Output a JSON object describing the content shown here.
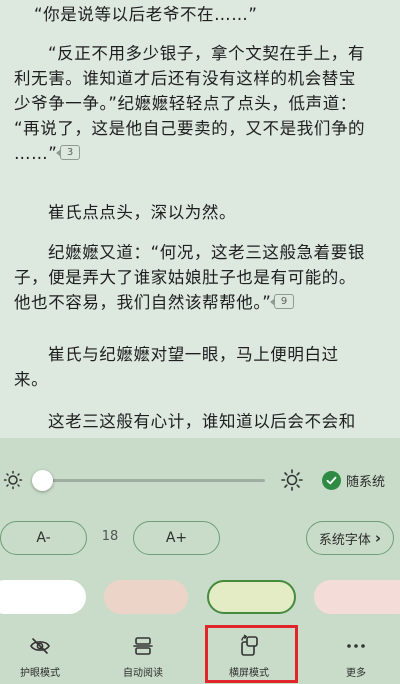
{
  "reader": {
    "paragraphs": [
      {
        "lines": [
          "“你是说等以后老爷不在……”"
        ],
        "badge": ""
      },
      {
        "lines": [
          "“反正不用多少银子，拿个文契在手上，有",
          "利无害。谁知道才后还有没有这样的机会替宝",
          "少爷争一争。”纪嬷嬷轻轻点了点头，低声道：",
          "“再说了，这是他自己要卖的，又不是我们争的",
          "……”"
        ],
        "badge": "3"
      },
      {
        "lines": [
          "崔氏点点头，深以为然。"
        ],
        "badge": ""
      },
      {
        "lines": [
          "纪嬷嬷又道：“何况，这老三这般急着要银",
          "子，便是弄大了谁家姑娘肚子也是有可能的。",
          "他也不容易，我们自然该帮帮他。”"
        ],
        "badge": "9"
      },
      {
        "lines": [
          "崔氏与纪嬷嬷对望一眼，马上便明白过",
          "来。"
        ],
        "badge": ""
      },
      {
        "lines": [
          "这老三这般有心计，谁知道以后会不会和"
        ],
        "badge": ""
      }
    ]
  },
  "panel": {
    "brightness": {
      "level": 0.0,
      "icons": [
        "sun-small-icon",
        "sun-large-icon"
      ]
    },
    "follow_system": {
      "label": "随系统",
      "checked": true,
      "icon": "check-circle-icon"
    },
    "font": {
      "decrease_label": "A-",
      "size_value": "18",
      "increase_label": "A+",
      "face_label": "系统字体",
      "face_chevron": "›"
    },
    "backgrounds": [
      {
        "name": "white",
        "color": "#ffffff",
        "selected": false
      },
      {
        "name": "beige-pink",
        "color": "#ecd5c8",
        "selected": false
      },
      {
        "name": "light-green",
        "color": "#e4ecc6",
        "selected": true
      },
      {
        "name": "rose",
        "color": "#f4dcd8",
        "selected": false
      }
    ],
    "tabs": [
      {
        "label": "护眼模式",
        "icon": "eye-off-icon"
      },
      {
        "label": "自动阅读",
        "icon": "auto-read-icon"
      },
      {
        "label": "横屏模式",
        "icon": "rotate-screen-icon",
        "highlighted": true
      },
      {
        "label": "更多",
        "icon": "more-dots-icon"
      }
    ]
  },
  "colors": {
    "page_bg": "#dde8df",
    "panel_bg": "#c9dcc9",
    "accent_green": "#2f8a44",
    "highlight_red": "#e0262b"
  }
}
